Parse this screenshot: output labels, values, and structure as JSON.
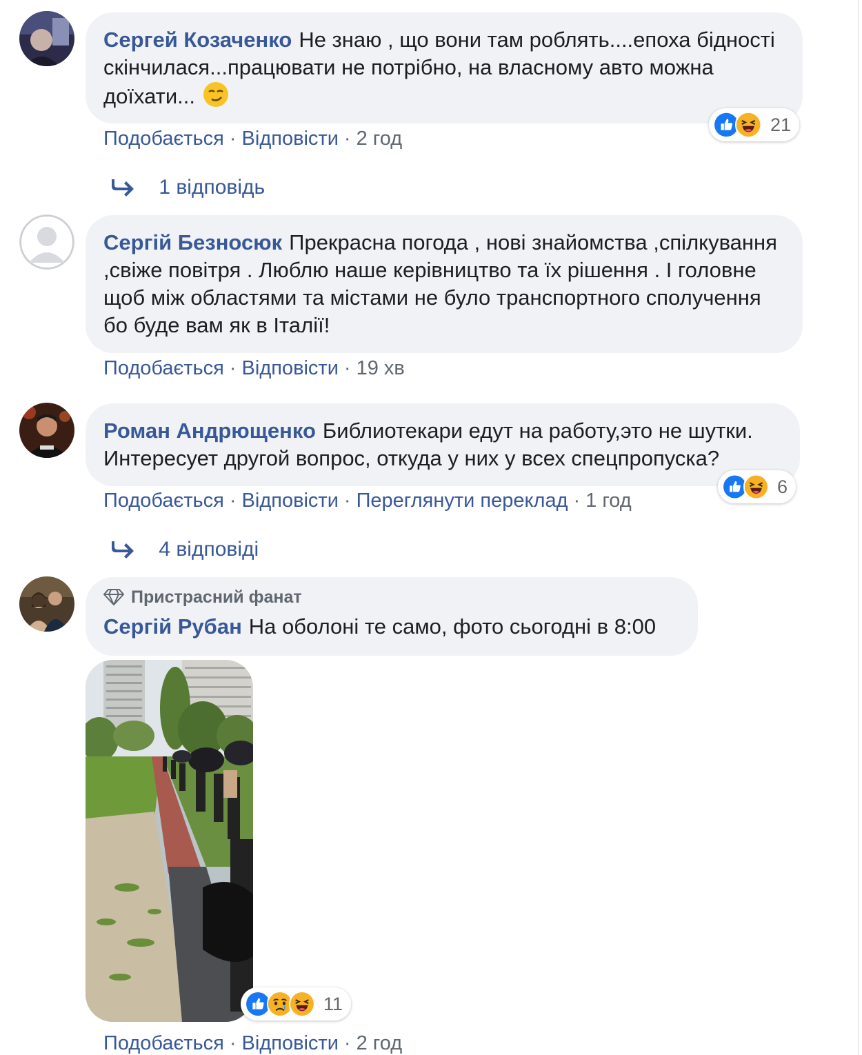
{
  "colors": {
    "link": "#385898",
    "meta": "#606770",
    "bubble": "#f0f2f5",
    "like": "#1877f2",
    "haha": "#f7b125"
  },
  "comments": [
    {
      "author": "Сергей Козаченко",
      "text": "Не знаю , що вони там роблять....епоха бідності скінчилася...працювати не потрібно, на власному авто можна доїхати...",
      "emoji": "smirk-emoji",
      "actions": {
        "like": "Подобається",
        "reply": "Відповісти",
        "time": "2 год"
      },
      "reactions": {
        "icons": [
          "like-icon",
          "haha-icon"
        ],
        "count": "21"
      },
      "replies": "1 відповідь"
    },
    {
      "author": "Сергій Безносюк",
      "text": "Прекрасна погода , нові знайомства ,спілкування ,свіже повітря . Люблю наше керівництво та їх рішення . І головне щоб між областями та містами не було транспортного сполучення бо буде вам як в Італії!",
      "actions": {
        "like": "Подобається",
        "reply": "Відповісти",
        "time": "19 хв"
      }
    },
    {
      "author": "Роман Андрющенко",
      "text": "Библиотекари едут на работу,это не шутки. Интересует другой вопрос, откуда у них у всех спецпропуска?",
      "actions": {
        "like": "Подобається",
        "reply": "Відповісти",
        "translate": "Переглянути переклад",
        "time": "1 год"
      },
      "reactions": {
        "icons": [
          "like-icon",
          "haha-icon"
        ],
        "count": "6"
      },
      "replies": "4 відповіді"
    },
    {
      "badge": "Пристрасний фанат",
      "badge_icon": "diamond-icon",
      "author": "Сергій Рубан",
      "text": "На оболоні те само, фото сьогодні в 8:00",
      "photo": "queue-photo",
      "actions": {
        "like": "Подобається",
        "reply": "Відповісти",
        "time": "2 год"
      },
      "reactions": {
        "icons": [
          "like-icon",
          "sad-icon",
          "haha-icon"
        ],
        "count": "11"
      }
    }
  ]
}
